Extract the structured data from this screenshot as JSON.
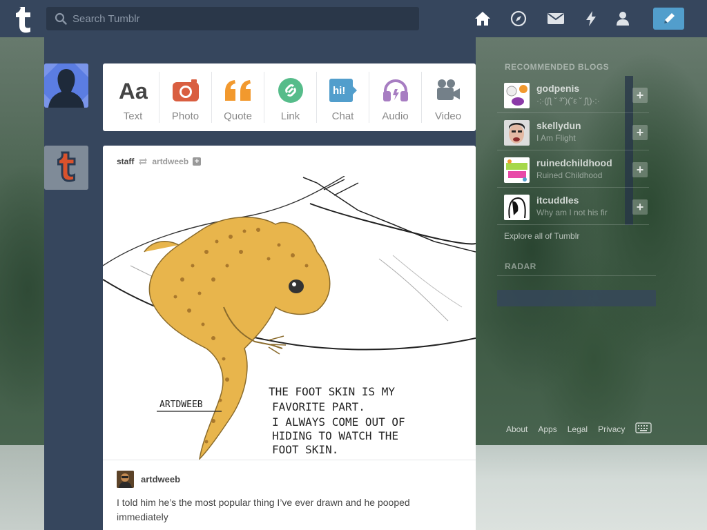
{
  "header": {
    "search_placeholder": "Search Tumblr"
  },
  "post_types": [
    {
      "label": "Text",
      "icon": "text-icon",
      "color": "#444444"
    },
    {
      "label": "Photo",
      "icon": "camera-icon",
      "color": "#d95e40"
    },
    {
      "label": "Quote",
      "icon": "quote-icon",
      "color": "#f2992e"
    },
    {
      "label": "Link",
      "icon": "link-icon",
      "color": "#56bc8a"
    },
    {
      "label": "Chat",
      "icon": "chat-icon",
      "color": "#529ecc"
    },
    {
      "label": "Audio",
      "icon": "headphones-icon",
      "color": "#a77dc2"
    },
    {
      "label": "Video",
      "icon": "video-camera-icon",
      "color": "#748089"
    }
  ],
  "chat_icon_text": "hi!",
  "post": {
    "poster": "staff",
    "reblogged_from": "artdweeb",
    "author": "artdweeb",
    "caption": "I told him he’s the most popular thing I’ve ever drawn and he pooped immediately",
    "artwork": {
      "signature": "ARTDWEEB",
      "lines": [
        "THE FOOT SKIN IS MY",
        "FAVORITE PART.",
        "I ALWAYS COME OUT OF",
        "HIDING TO WATCH THE",
        "FOOT SKIN."
      ]
    }
  },
  "sidebar": {
    "recommended_title": "RECOMMENDED BLOGS",
    "blogs": [
      {
        "name": "godpenis",
        "desc": "·:·(ʃƪ ˘ ³˘)(˘ε ˘ ʃƪ)·:·"
      },
      {
        "name": "skellydun",
        "desc": "I Am Flight"
      },
      {
        "name": "ruinedchildhood",
        "desc": "Ruined Childhood"
      },
      {
        "name": "itcuddles",
        "desc": "Why am I not his fir"
      }
    ],
    "follow_symbol": "+",
    "explore": "Explore all of Tumblr",
    "radar_title": "RADAR"
  },
  "footer": {
    "links": [
      "About",
      "Apps",
      "Legal",
      "Privacy"
    ]
  },
  "colors": {
    "header": "#36465d",
    "accent": "#529ecc"
  }
}
